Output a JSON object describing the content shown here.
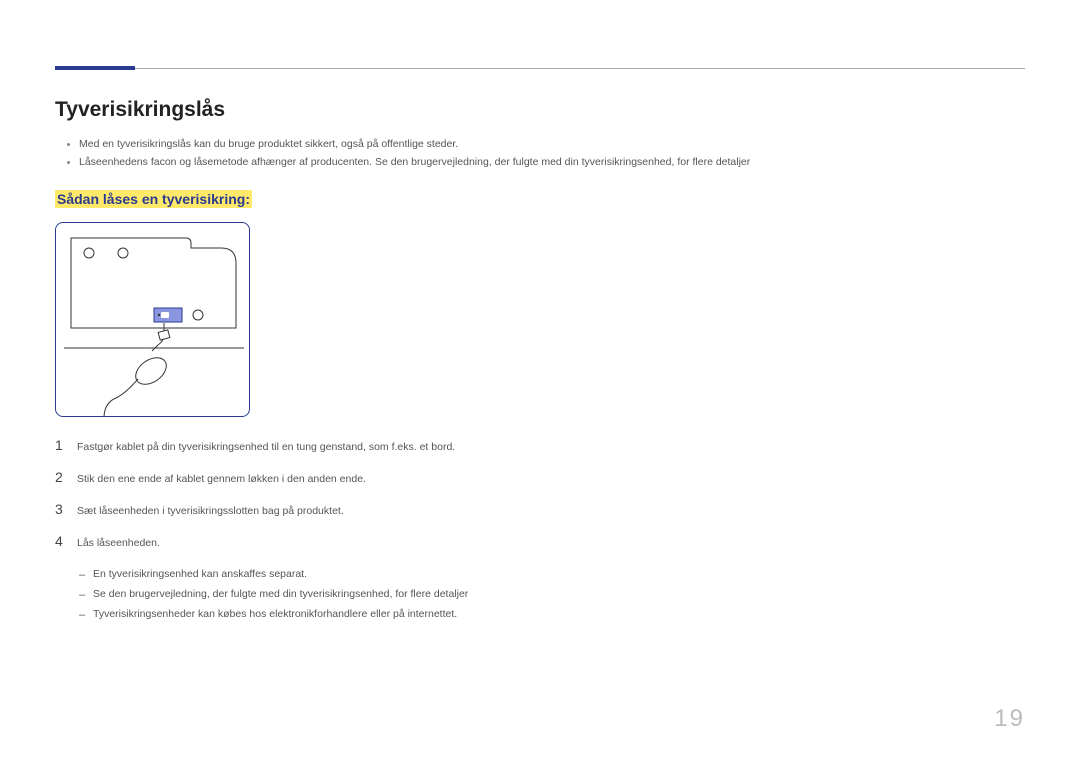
{
  "section_title": "Tyverisikringslås",
  "intro_bullets": [
    "Med en tyverisikringslås kan du bruge produktet sikkert, også på offentlige steder.",
    "Låseenhedens facon og låsemetode afhænger af producenten. Se den brugervejledning, der fulgte med din tyverisikringsenhed, for flere detaljer"
  ],
  "sub_title": "Sådan låses en tyverisikring:",
  "steps": [
    {
      "num": "1",
      "text": "Fastgør kablet på din tyverisikringsenhed til en tung genstand, som f.eks. et bord."
    },
    {
      "num": "2",
      "text": "Stik den ene ende af kablet gennem løkken i den anden ende."
    },
    {
      "num": "3",
      "text": "Sæt låseenheden i tyverisikringsslotten bag på produktet."
    },
    {
      "num": "4",
      "text": "Lås låseenheden."
    }
  ],
  "dash_notes": [
    "En tyverisikringsenhed kan anskaffes separat.",
    "Se den brugervejledning, der fulgte med din tyverisikringsenhed, for flere detaljer",
    "Tyverisikringsenheder kan købes hos elektronikforhandlere eller på internettet."
  ],
  "page_number": "19"
}
